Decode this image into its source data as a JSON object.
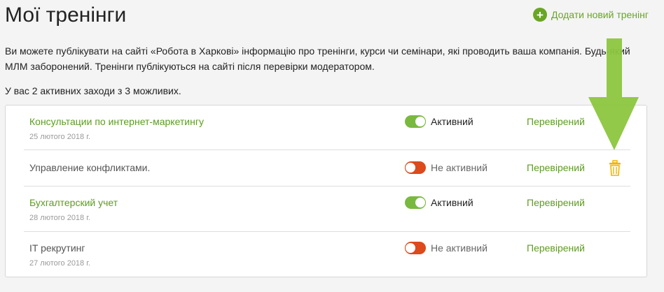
{
  "header": {
    "title": "Мої тренінги",
    "add_label": "Додати новий тренінг"
  },
  "intro": {
    "text": "Ви можете публікувати на сайті «Робота в Харкові» інформацію про тренінги, курси чи семінари, які проводить ваша компанія. Будь-який МЛМ заборонений. Тренінги публікуються на сайті після перевірки модератором.",
    "count": "У вас 2 активних заходи з 3 можливих."
  },
  "trainings": [
    {
      "title": "Консультации по интернет-маркетингу",
      "date": "25 лютого 2018 г.",
      "active": true,
      "status": "Активний",
      "verification": "Перевірений"
    },
    {
      "title": "Управление конфликтами.",
      "date": "",
      "active": false,
      "status": "Не активний",
      "verification": "Перевірений"
    },
    {
      "title": "Бухгалтерский учет",
      "date": "28 лютого 2018 г.",
      "active": true,
      "status": "Активний",
      "verification": "Перевірений"
    },
    {
      "title": "IT рекрутинг",
      "date": "27 лютого 2018 г.",
      "active": false,
      "status": "Не активний",
      "verification": "Перевірений"
    }
  ],
  "colors": {
    "accent_green": "#5d9c1f",
    "toggle_on": "#7ab940",
    "toggle_off": "#dd4a1c",
    "trash": "#f0b400",
    "arrow": "#8cc63f"
  },
  "icons": {
    "add": "plus-circle-icon",
    "delete": "trash-icon",
    "pointer": "down-arrow-icon"
  }
}
